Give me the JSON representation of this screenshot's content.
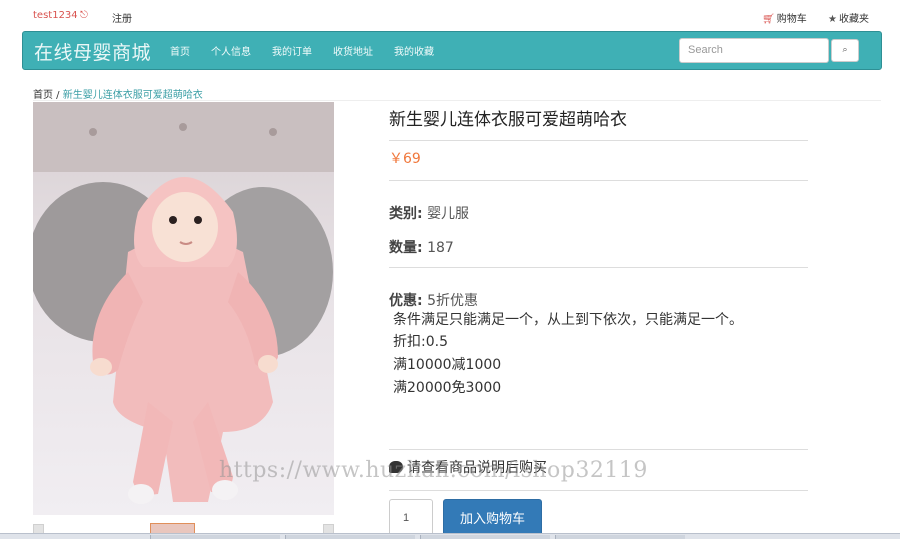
{
  "topbar": {
    "username": "test1234",
    "logout_icon": "logout-icon",
    "register": "注册",
    "cart_label": "购物车",
    "favorites_label": "收藏夹"
  },
  "navbar": {
    "brand": "在线母婴商城",
    "links": [
      "首页",
      "个人信息",
      "我的订单",
      "收货地址",
      "我的收藏"
    ],
    "search_placeholder": "Search",
    "search_icon": "search-icon",
    "brand_color": "#3fb0b5"
  },
  "breadcrumb": {
    "home": "首页",
    "separator": " / ",
    "current": "新生婴儿连体衣服可爱超萌哈衣"
  },
  "product": {
    "title": "新生婴儿连体衣服可爱超萌哈衣",
    "price": "￥69",
    "category_label": "类别:",
    "category_value": "婴儿服",
    "quantity_label": "数量:",
    "quantity_value": "187",
    "promo_label": "优惠:",
    "promo_value": "5折优惠",
    "promo_lines": [
      "条件满足只能满足一个，从上到下依次，只能满足一个。",
      "折扣:0.5",
      "满10000减1000",
      "满20000免3000"
    ],
    "notice": "请查看商品说明后购买",
    "qty_input": "1",
    "add_to_cart": "加入购物车",
    "price_color": "#f0783c",
    "button_color": "#337ab7"
  },
  "watermark": "https://www.huzhan.com/ishop32119"
}
